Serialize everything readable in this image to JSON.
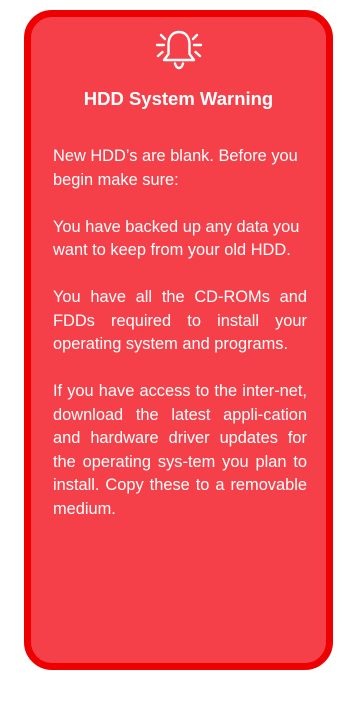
{
  "warning": {
    "icon": "bell-alert-icon",
    "title": "HDD System Warning",
    "intro": "New HDD’s are blank. Before you begin make sure:",
    "items": [
      "You have backed up any data you want to keep from your old HDD.",
      "You have all the CD-ROMs and FDDs required to install your operating system and programs.",
      "If you have access to the inter-net, download the latest appli-cation and hardware driver updates for the operating sys-tem you plan to install. Copy these to a removable medium."
    ]
  },
  "colors": {
    "panel_fill": "#f5404a",
    "panel_border": "#ee0000",
    "text": "#ffffff"
  }
}
